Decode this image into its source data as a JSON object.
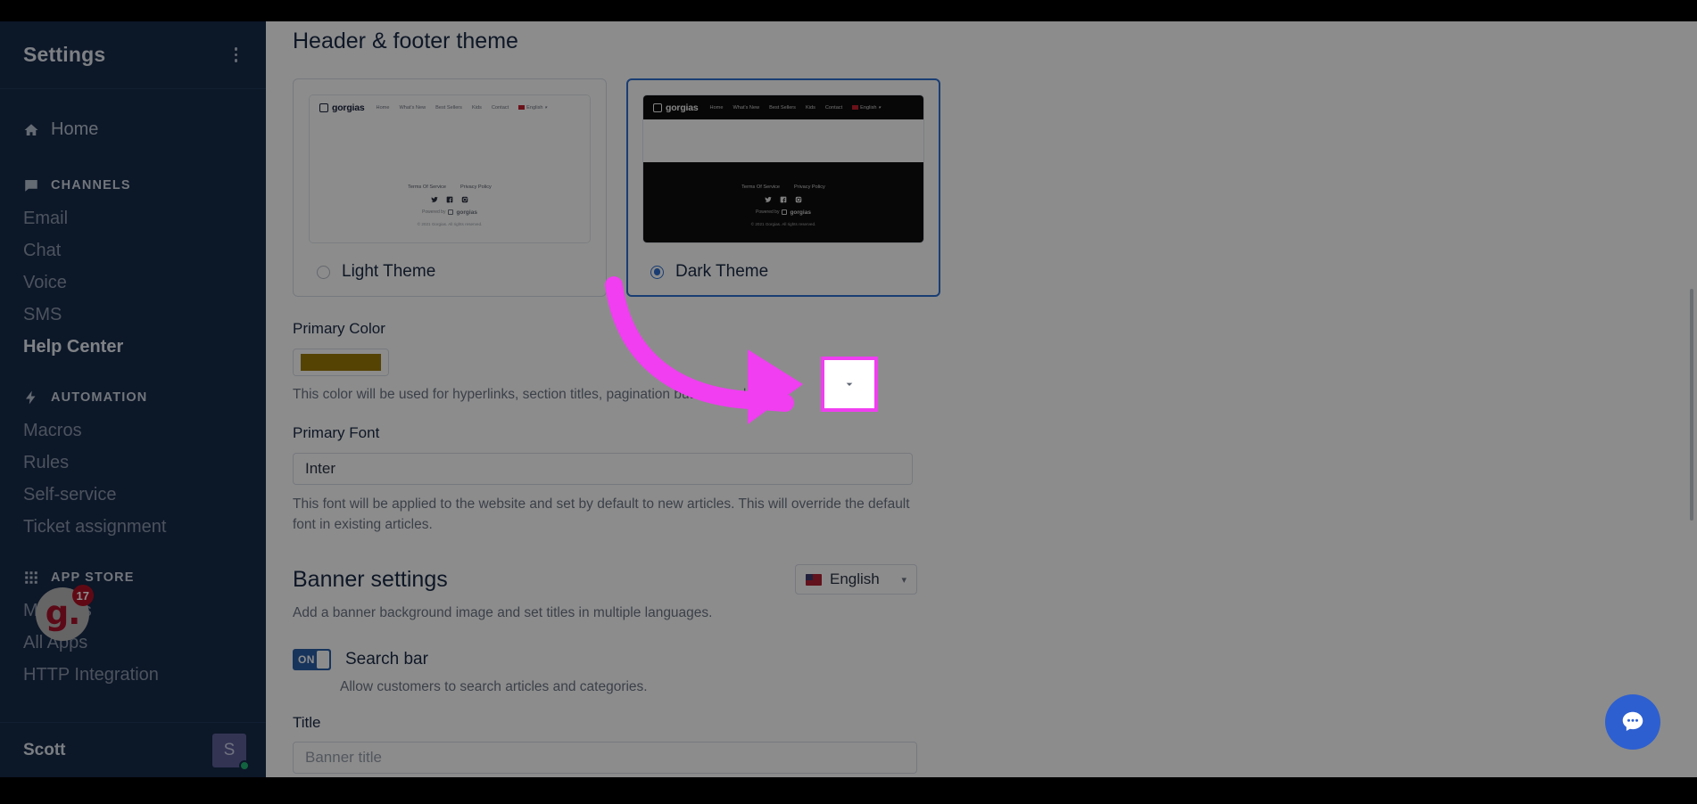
{
  "sidebar": {
    "title": "Settings",
    "menu_icon": "kebab-menu-icon",
    "home": {
      "label": "Home",
      "icon": "home-icon"
    },
    "sections": [
      {
        "label": "CHANNELS",
        "icon": "chat-bubble-icon",
        "items": [
          {
            "label": "Email",
            "active": false
          },
          {
            "label": "Chat",
            "active": false
          },
          {
            "label": "Voice",
            "active": false
          },
          {
            "label": "SMS",
            "active": false
          },
          {
            "label": "Help Center",
            "active": true
          }
        ]
      },
      {
        "label": "AUTOMATION",
        "icon": "lightning-bolt-icon",
        "items": [
          {
            "label": "Macros",
            "active": false
          },
          {
            "label": "Rules",
            "active": false
          },
          {
            "label": "Self-service",
            "active": false
          },
          {
            "label": "Ticket assignment",
            "active": false
          }
        ]
      },
      {
        "label": "APP STORE",
        "icon": "grid-icon",
        "items": [
          {
            "label": "My Apps",
            "active": false
          },
          {
            "label": "All Apps",
            "active": false
          },
          {
            "label": "HTTP Integration",
            "active": false
          }
        ]
      }
    ],
    "user": {
      "name": "Scott",
      "avatar_initial": "S",
      "status": "online"
    },
    "launcher": {
      "mark": "g.",
      "badge_count": "17"
    }
  },
  "main": {
    "header_footer_theme": {
      "title": "Header & footer theme",
      "themes": [
        {
          "label": "Light Theme",
          "selected": false,
          "preview": {
            "brand": "gorgias",
            "nav": [
              "Home",
              "What's New",
              "Best Sellers",
              "Kids",
              "Contact"
            ],
            "lang": "English",
            "footer_links": [
              "Terms Of Service",
              "Privacy Policy"
            ],
            "social": [
              "twitter-icon",
              "facebook-icon",
              "instagram-icon"
            ],
            "powered_by": "Powered by",
            "powered_brand": "gorgias",
            "copyright": "© 2021 Gorgias. All rights reserved."
          }
        },
        {
          "label": "Dark Theme",
          "selected": true,
          "preview": {
            "brand": "gorgias",
            "nav": [
              "Home",
              "What's New",
              "Best Sellers",
              "Kids",
              "Contact"
            ],
            "lang": "English",
            "footer_links": [
              "Terms Of Service",
              "Privacy Policy"
            ],
            "social": [
              "twitter-icon",
              "facebook-icon",
              "instagram-icon"
            ],
            "powered_by": "Powered by",
            "powered_brand": "gorgias",
            "copyright": "© 2021 Gorgias. All rights reserved."
          }
        }
      ]
    },
    "primary_color": {
      "label": "Primary Color",
      "value": "#9c7b08",
      "helper": "This color will be used for hyperlinks, section titles, pagination buttons and icons."
    },
    "primary_font": {
      "label": "Primary Font",
      "value": "Inter",
      "helper": "This font will be applied to the website and set by default to new articles. This will override the default font in existing articles.",
      "dropdown_icon": "chevron-down-icon"
    },
    "banner_settings": {
      "title": "Banner settings",
      "description": "Add a banner background image and set titles in multiple languages.",
      "language": {
        "value": "English",
        "flag": "us-flag-icon",
        "caret": "chevron-down-icon"
      },
      "search_bar": {
        "toggle_state": "ON",
        "label": "Search bar",
        "helper": "Allow customers to search articles and categories."
      },
      "title_field": {
        "label": "Title",
        "placeholder": "Banner title",
        "value": ""
      }
    }
  },
  "chat_widget": {
    "icon": "chat-dots-icon"
  },
  "annotation": {
    "type": "arrow",
    "color": "#f03ef0",
    "target": "primary-font-dropdown-button"
  },
  "colors": {
    "sidebar_bg": "#172b4a",
    "accent_blue": "#2f6fd0",
    "highlight_magenta": "#f03ef0",
    "toggle_on": "#2a5fa8"
  }
}
